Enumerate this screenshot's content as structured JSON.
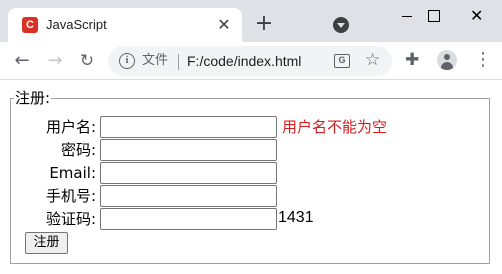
{
  "browser": {
    "tab": {
      "favicon_letter": "C",
      "title": "JavaScript",
      "close_glyph": "✕"
    },
    "new_tab_glyph": "+",
    "address_bar": {
      "scheme_label": "文件",
      "url": "F:/code/index.html"
    },
    "icons": {
      "back": "arrow-left",
      "forward": "arrow-right",
      "reload": "reload",
      "info": "info",
      "translate": "translate",
      "bookmark": "star",
      "extensions": "puzzle",
      "profile": "person",
      "menu": "kebab",
      "tab_search": "chevron-down"
    },
    "colors": {
      "chrome_bg": "#dee1e6",
      "favicon": "#d93025"
    }
  },
  "form": {
    "legend": "注册:",
    "fields": [
      {
        "label": "用户名:",
        "value": ""
      },
      {
        "label": "密码:",
        "value": ""
      },
      {
        "label": "Email:",
        "value": ""
      },
      {
        "label": "手机号:",
        "value": ""
      },
      {
        "label": "验证码:",
        "value": ""
      }
    ],
    "username_error": "用户名不能为空",
    "captcha_code": "1431",
    "submit_label": "注册",
    "error_color": "#d51c1c"
  }
}
